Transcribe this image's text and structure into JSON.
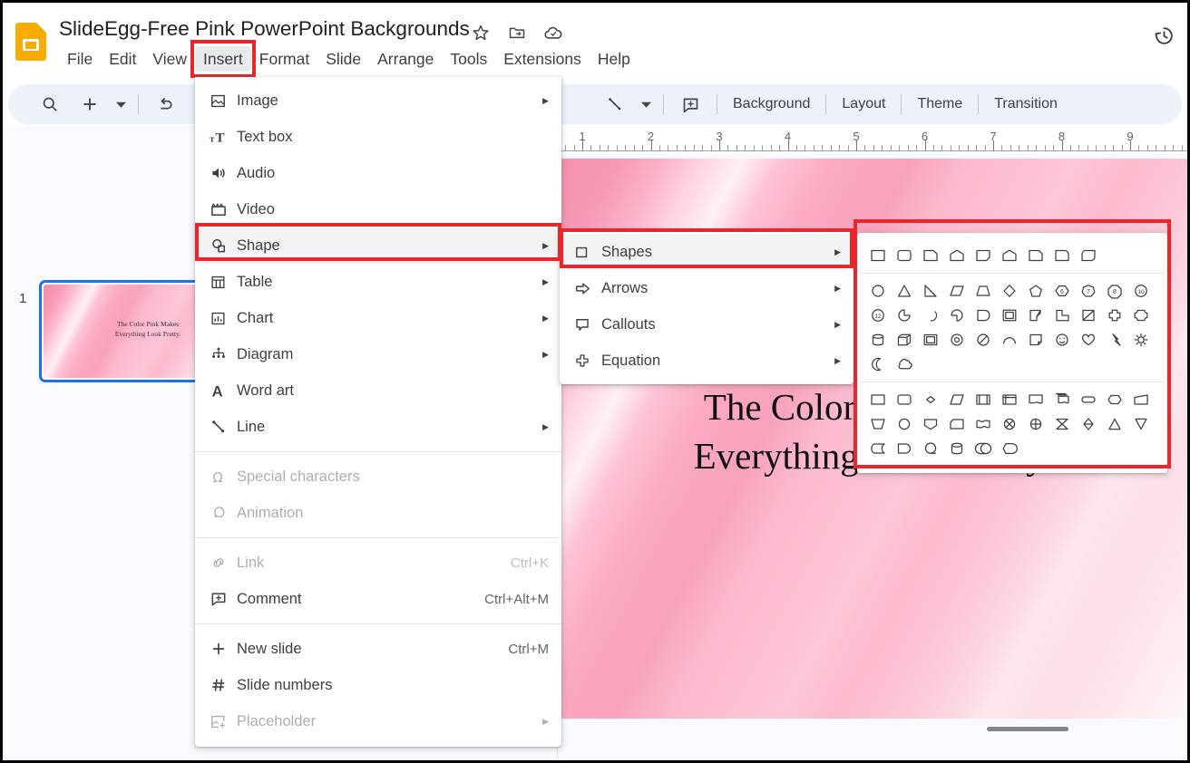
{
  "app": {
    "name": "Google Slides",
    "logo_icon": "slides-logo-icon"
  },
  "titlebar": {
    "doc_title": "SlideEgg-Free Pink PowerPoint Backgrounds",
    "icons": [
      {
        "name": "star-icon",
        "label": "Star"
      },
      {
        "name": "move-to-folder-icon",
        "label": "Move"
      },
      {
        "name": "cloud-saved-icon",
        "label": "Saved to Drive"
      }
    ],
    "history_icon": "version-history-icon"
  },
  "menubar": {
    "items": [
      {
        "label": "File",
        "active": false
      },
      {
        "label": "Edit",
        "active": false
      },
      {
        "label": "View",
        "active": false
      },
      {
        "label": "Insert",
        "active": true,
        "highlighted": true
      },
      {
        "label": "Format",
        "active": false
      },
      {
        "label": "Slide",
        "active": false
      },
      {
        "label": "Arrange",
        "active": false
      },
      {
        "label": "Tools",
        "active": false
      },
      {
        "label": "Extensions",
        "active": false
      },
      {
        "label": "Help",
        "active": false
      }
    ]
  },
  "toolbar": {
    "left_icons": [
      {
        "name": "search-icon"
      },
      {
        "name": "add-slide-icon"
      },
      {
        "name": "add-slide-dropdown-icon"
      },
      {
        "name": "undo-icon"
      },
      {
        "name": "redo-icon"
      }
    ],
    "right_icons": [
      {
        "name": "line-tool-icon"
      },
      {
        "name": "line-dropdown-icon"
      },
      {
        "name": "add-comment-icon"
      }
    ],
    "text_buttons": [
      {
        "label": "Background"
      },
      {
        "label": "Layout"
      },
      {
        "label": "Theme"
      },
      {
        "label": "Transition"
      }
    ]
  },
  "ruler": {
    "labels": [
      "1",
      "2",
      "3",
      "4",
      "5",
      "6",
      "7",
      "8",
      "9"
    ]
  },
  "filmstrip": {
    "slides": [
      {
        "number": "1",
        "selected": true,
        "text_line1": "The Color Pink Makes",
        "text_line2": "Everything Look Pretty.",
        "badge": "thumbnail-badge"
      }
    ]
  },
  "canvas": {
    "slide_text_line1": "The Color Pink Makes",
    "slide_text_line2": "Everything Look Pretty.",
    "scrollbar": "horizontal-scrollbar"
  },
  "insert_menu": {
    "open": true,
    "groups": [
      {
        "items": [
          {
            "label": "Image",
            "icon": "image-icon",
            "submenu": true,
            "accel": "",
            "disabled": false,
            "selected": false,
            "highlighted": false
          },
          {
            "label": "Text box",
            "icon": "text-box-icon",
            "submenu": false,
            "accel": "",
            "disabled": false,
            "selected": false,
            "highlighted": false
          },
          {
            "label": "Audio",
            "icon": "audio-icon",
            "submenu": false,
            "accel": "",
            "disabled": false,
            "selected": false,
            "highlighted": false
          },
          {
            "label": "Video",
            "icon": "video-icon",
            "submenu": false,
            "accel": "",
            "disabled": false,
            "selected": false,
            "highlighted": false
          },
          {
            "label": "Shape",
            "icon": "shape-icon",
            "submenu": true,
            "accel": "",
            "disabled": false,
            "selected": true,
            "highlighted": true
          },
          {
            "label": "Table",
            "icon": "table-icon",
            "submenu": true,
            "accel": "",
            "disabled": false,
            "selected": false,
            "highlighted": false
          },
          {
            "label": "Chart",
            "icon": "chart-icon",
            "submenu": true,
            "accel": "",
            "disabled": false,
            "selected": false,
            "highlighted": false
          },
          {
            "label": "Diagram",
            "icon": "diagram-icon",
            "submenu": true,
            "accel": "",
            "disabled": false,
            "selected": false,
            "highlighted": false
          },
          {
            "label": "Word art",
            "icon": "word-art-icon",
            "submenu": false,
            "accel": "",
            "disabled": false,
            "selected": false,
            "highlighted": false
          },
          {
            "label": "Line",
            "icon": "line-icon",
            "submenu": true,
            "accel": "",
            "disabled": false,
            "selected": false,
            "highlighted": false
          }
        ]
      },
      {
        "items": [
          {
            "label": "Special characters",
            "icon": "omega-icon",
            "submenu": false,
            "accel": "",
            "disabled": true,
            "selected": false,
            "highlighted": false
          },
          {
            "label": "Animation",
            "icon": "animation-icon",
            "submenu": false,
            "accel": "",
            "disabled": true,
            "selected": false,
            "highlighted": false
          }
        ]
      },
      {
        "items": [
          {
            "label": "Link",
            "icon": "link-icon",
            "submenu": false,
            "accel": "Ctrl+K",
            "disabled": true,
            "selected": false,
            "highlighted": false
          },
          {
            "label": "Comment",
            "icon": "comment-icon",
            "submenu": false,
            "accel": "Ctrl+Alt+M",
            "disabled": false,
            "selected": false,
            "highlighted": false
          }
        ]
      },
      {
        "items": [
          {
            "label": "New slide",
            "icon": "plus-icon",
            "submenu": false,
            "accel": "Ctrl+M",
            "disabled": false,
            "selected": false,
            "highlighted": false
          },
          {
            "label": "Slide numbers",
            "icon": "hash-icon",
            "submenu": false,
            "accel": "",
            "disabled": false,
            "selected": false,
            "highlighted": false
          },
          {
            "label": "Placeholder",
            "icon": "placeholder-icon",
            "submenu": true,
            "accel": "",
            "disabled": true,
            "selected": false,
            "highlighted": false
          }
        ]
      }
    ]
  },
  "shape_submenu": {
    "open": true,
    "items": [
      {
        "label": "Shapes",
        "icon": "square-outline-icon",
        "submenu": true,
        "selected": true,
        "highlighted": true
      },
      {
        "label": "Arrows",
        "icon": "arrow-right-icon",
        "submenu": true,
        "selected": false,
        "highlighted": false
      },
      {
        "label": "Callouts",
        "icon": "callout-icon",
        "submenu": true,
        "selected": false,
        "highlighted": false
      },
      {
        "label": "Equation",
        "icon": "plus-cross-icon",
        "submenu": true,
        "selected": false,
        "highlighted": false
      }
    ]
  },
  "shapes_palette": {
    "open": true,
    "highlighted": true,
    "groups": [
      {
        "name": "recent-shapes",
        "shapes": [
          "rectangle",
          "rounded-rectangle",
          "snip-single-corner-rectangle",
          "pentagon-home",
          "snip-diagonal-corner-rectangle",
          "round-single-corner-rectangle",
          "snip-corner-rectangle",
          "round-corner-rectangle",
          "round-diagonal-corner-rectangle"
        ]
      },
      {
        "name": "basic-shapes",
        "shapes": [
          "ellipse",
          "triangle",
          "right-triangle",
          "parallelogram",
          "trapezoid",
          "diamond",
          "pentagon",
          "hexagon-6",
          "heptagon-7",
          "octagon-8",
          "decagon-10",
          "dodecagon-12",
          "pie",
          "chord",
          "teardrop",
          "frame-half",
          "frame",
          "corner-bent",
          "L-shape",
          "diagonal-stripe",
          "cross",
          "plaque",
          "cylinder",
          "cube",
          "bevel",
          "donut",
          "no-symbol",
          "arc",
          "folded-corner",
          "smiley-face",
          "heart",
          "lightning-bolt",
          "sun",
          "moon",
          "cloud"
        ]
      },
      {
        "name": "flowchart-shapes",
        "shapes": [
          "process",
          "alternate-process",
          "decision",
          "data",
          "predefined-process",
          "internal-storage",
          "document",
          "multidocument",
          "terminator",
          "preparation",
          "manual-input",
          "manual-operation",
          "connector",
          "off-page-connector",
          "card",
          "punched-tape",
          "summing-junction",
          "or-gate",
          "collate",
          "sort",
          "extract",
          "merge",
          "stored-data",
          "delay",
          "sequential-access",
          "magnetic-disk",
          "direct-access-storage",
          "display"
        ]
      }
    ]
  },
  "colors": {
    "accent_blue": "#1a73e8",
    "annotation_red": "#e8262b",
    "toolbar_bg": "#edf2fa",
    "logo_yellow": "#F9AB00",
    "slide_pink": "#f8a3bb"
  }
}
